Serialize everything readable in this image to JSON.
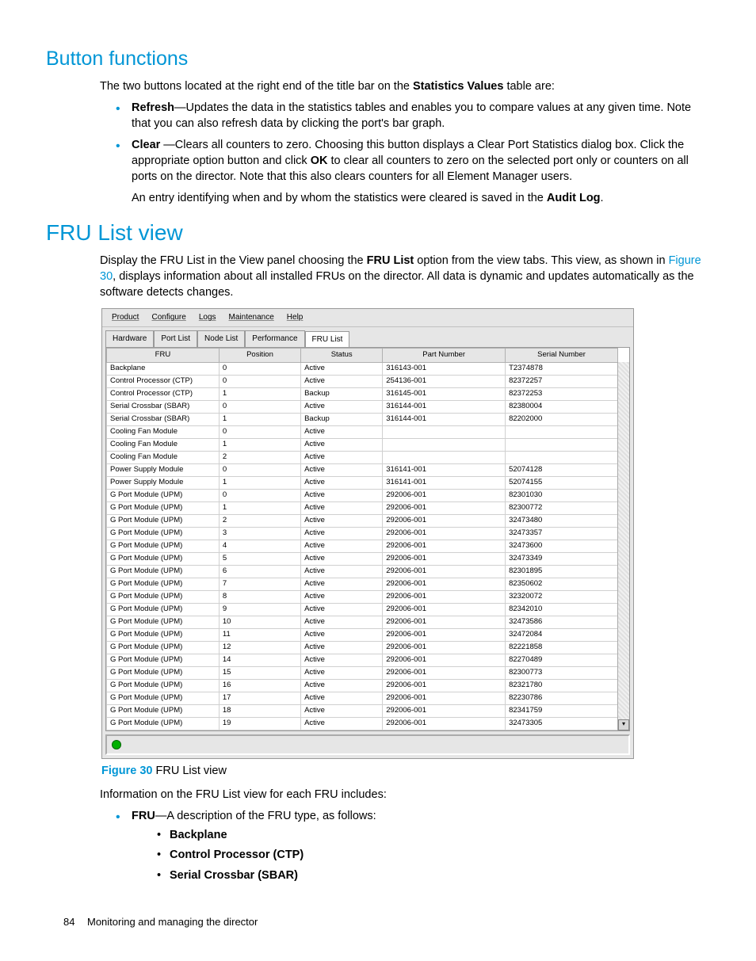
{
  "headings": {
    "button_functions": "Button functions",
    "fru_list_view": "FRU List view"
  },
  "para": {
    "intro": "The two buttons located at the right end of the title bar on the ",
    "intro_bold": "Statistics Values",
    "intro_tail": " table are:",
    "refresh_bold": "Refresh",
    "refresh_text": "—Updates the data in the statistics tables and enables you to compare values at any given time. Note that you can also refresh data by clicking the port's bar graph.",
    "clear_bold": "Clear",
    "clear_text_a": " —Clears all counters to zero. Choosing this button displays a Clear Port Statistics dialog box. Click the appropriate option button and click ",
    "clear_ok": "OK",
    "clear_text_b": " to clear all counters to zero on the selected port only or counters on all ports on the director. Note that this also clears counters for all Element Manager users.",
    "audit_a": "An entry identifying when and by whom the statistics were cleared is saved in the ",
    "audit_bold": "Audit Log",
    "audit_tail": ".",
    "fru_p1a": "Display the FRU List in the View panel choosing the ",
    "fru_p1_bold": "FRU List",
    "fru_p1b": " option from the view tabs. This view, as shown in ",
    "fru_p1_link": "Figure 30",
    "fru_p1c": ", displays information about all installed FRUs on the director. All data is dynamic and updates automatically as the software detects changes.",
    "caption_label": "Figure 30",
    "caption_text": " FRU List view",
    "info_line": "Information on the FRU List view for each FRU includes:",
    "fru_item_bold": "FRU",
    "fru_item_text": "—A description of the FRU type, as follows:",
    "sub1": "Backplane",
    "sub2": "Control Processor (CTP)",
    "sub3": "Serial Crossbar (SBAR)"
  },
  "menus": [
    "Product",
    "Configure",
    "Logs",
    "Maintenance",
    "Help"
  ],
  "tabs": [
    "Hardware",
    "Port List",
    "Node List",
    "Performance",
    "FRU List"
  ],
  "columns": [
    "FRU",
    "Position",
    "Status",
    "Part Number",
    "Serial Number"
  ],
  "chart_data": {
    "type": "table",
    "title": "FRU List view",
    "columns": [
      "FRU",
      "Position",
      "Status",
      "Part Number",
      "Serial Number"
    ],
    "rows": [
      [
        "Backplane",
        "0",
        "Active",
        "316143-001",
        "T2374878"
      ],
      [
        "Control Processor (CTP)",
        "0",
        "Active",
        "254136-001",
        "82372257"
      ],
      [
        "Control Processor (CTP)",
        "1",
        "Backup",
        "316145-001",
        "82372253"
      ],
      [
        "Serial Crossbar (SBAR)",
        "0",
        "Active",
        "316144-001",
        "82380004"
      ],
      [
        "Serial Crossbar (SBAR)",
        "1",
        "Backup",
        "316144-001",
        "82202000"
      ],
      [
        "Cooling Fan Module",
        "0",
        "Active",
        "",
        ""
      ],
      [
        "Cooling Fan Module",
        "1",
        "Active",
        "",
        ""
      ],
      [
        "Cooling Fan Module",
        "2",
        "Active",
        "",
        ""
      ],
      [
        "Power Supply Module",
        "0",
        "Active",
        "316141-001",
        "52074128"
      ],
      [
        "Power Supply Module",
        "1",
        "Active",
        "316141-001",
        "52074155"
      ],
      [
        "G Port Module (UPM)",
        "0",
        "Active",
        "292006-001",
        "82301030"
      ],
      [
        "G Port Module (UPM)",
        "1",
        "Active",
        "292006-001",
        "82300772"
      ],
      [
        "G Port Module (UPM)",
        "2",
        "Active",
        "292006-001",
        "32473480"
      ],
      [
        "G Port Module (UPM)",
        "3",
        "Active",
        "292006-001",
        "32473357"
      ],
      [
        "G Port Module (UPM)",
        "4",
        "Active",
        "292006-001",
        "32473600"
      ],
      [
        "G Port Module (UPM)",
        "5",
        "Active",
        "292006-001",
        "32473349"
      ],
      [
        "G Port Module (UPM)",
        "6",
        "Active",
        "292006-001",
        "82301895"
      ],
      [
        "G Port Module (UPM)",
        "7",
        "Active",
        "292006-001",
        "82350602"
      ],
      [
        "G Port Module (UPM)",
        "8",
        "Active",
        "292006-001",
        "32320072"
      ],
      [
        "G Port Module (UPM)",
        "9",
        "Active",
        "292006-001",
        "82342010"
      ],
      [
        "G Port Module (UPM)",
        "10",
        "Active",
        "292006-001",
        "32473586"
      ],
      [
        "G Port Module (UPM)",
        "11",
        "Active",
        "292006-001",
        "32472084"
      ],
      [
        "G Port Module (UPM)",
        "12",
        "Active",
        "292006-001",
        "82221858"
      ],
      [
        "G Port Module (UPM)",
        "14",
        "Active",
        "292006-001",
        "82270489"
      ],
      [
        "G Port Module (UPM)",
        "15",
        "Active",
        "292006-001",
        "82300773"
      ],
      [
        "G Port Module (UPM)",
        "16",
        "Active",
        "292006-001",
        "82321780"
      ],
      [
        "G Port Module (UPM)",
        "17",
        "Active",
        "292006-001",
        "82230786"
      ],
      [
        "G Port Module (UPM)",
        "18",
        "Active",
        "292006-001",
        "82341759"
      ],
      [
        "G Port Module (UPM)",
        "19",
        "Active",
        "292006-001",
        "32473305"
      ]
    ]
  },
  "footer": {
    "page": "84",
    "chapter": "Monitoring and managing the director"
  }
}
